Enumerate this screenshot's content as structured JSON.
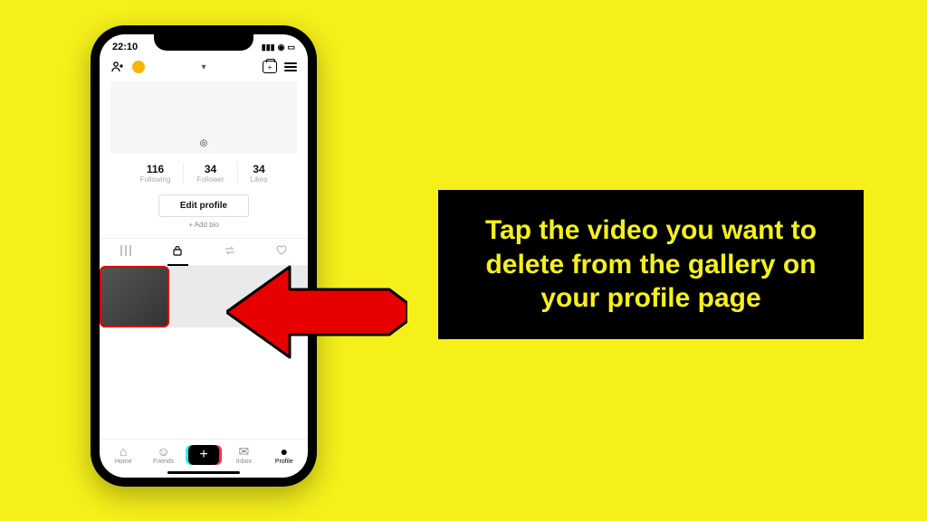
{
  "status": {
    "time": "22:10"
  },
  "stats": {
    "following": {
      "count": "116",
      "label": "Following"
    },
    "followers": {
      "count": "34",
      "label": "Follower"
    },
    "likes": {
      "count": "34",
      "label": "Likes"
    }
  },
  "buttons": {
    "edit_profile": "Edit profile",
    "add_bio": "+ Add bio"
  },
  "bottom_nav": {
    "home": "Home",
    "friends": "Friends",
    "inbox": "Inbox",
    "profile": "Profile"
  },
  "instruction": "Tap the video you want to delete from the gallery on your profile page"
}
